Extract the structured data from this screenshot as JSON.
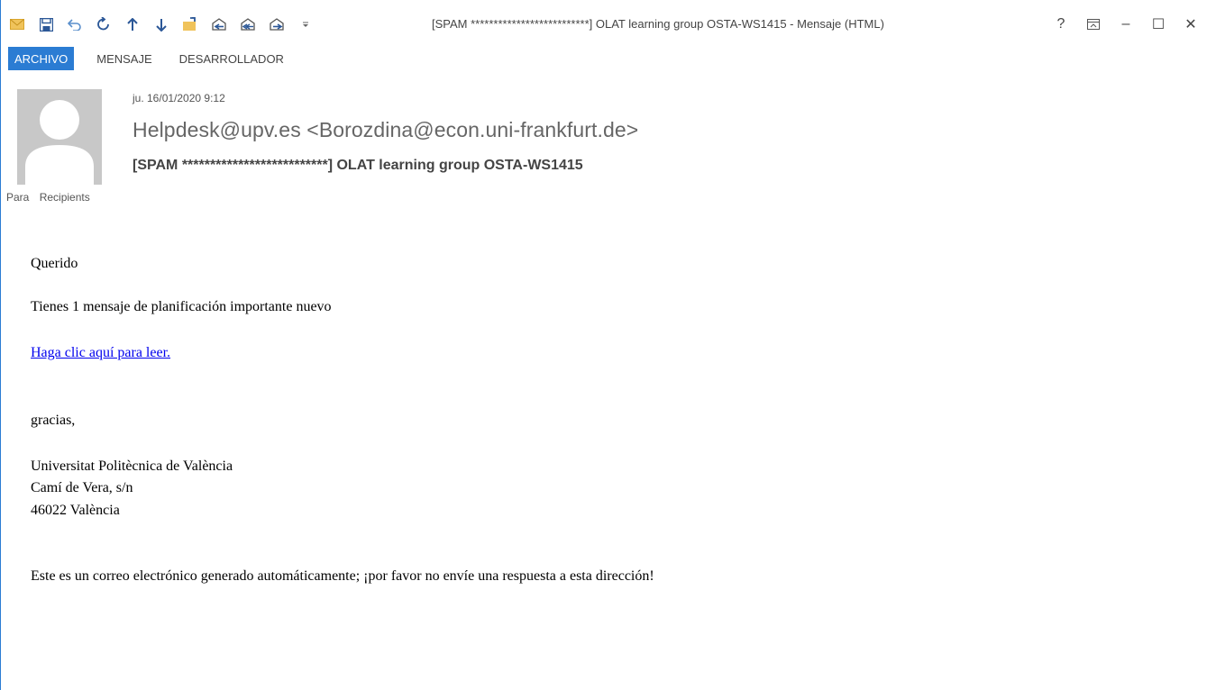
{
  "window": {
    "title": "[SPAM **************************] OLAT learning group OSTA-WS1415 - Mensaje (HTML)",
    "controls": {
      "help": "?",
      "restore_ribbon": "ribbon-display-icon",
      "minimize": "–",
      "maximize": "☐",
      "close": "✕"
    }
  },
  "quick_access": [
    "mail-icon",
    "save-icon",
    "undo-icon",
    "redo-icon",
    "up-arrow-icon",
    "down-arrow-icon",
    "move-folder-icon",
    "reply-icon",
    "reply-all-icon",
    "forward-icon",
    "customize-icon"
  ],
  "ribbon": {
    "tabs": [
      {
        "label": "ARCHIVO",
        "active": true
      },
      {
        "label": "MENSAJE",
        "active": false
      },
      {
        "label": "DESARROLLADOR",
        "active": false
      }
    ]
  },
  "header": {
    "date": "ju. 16/01/2020 9:12",
    "from": "Helpdesk@upv.es <Borozdina@econ.uni-frankfurt.de>",
    "subject": "[SPAM **************************] OLAT learning group OSTA-WS1415",
    "to_label": "Para",
    "to_value": "Recipients"
  },
  "body": {
    "greeting": "Querido",
    "line1": "Tienes 1 mensaje de planificación importante nuevo",
    "link": "Haga clic aquí para leer.",
    "thanks": "gracias,",
    "org1": "Universitat Politècnica de València",
    "org2": "Camí de Vera, s/n",
    "org3": "46022 València",
    "footer": "Este es un correo electrónico generado automáticamente; ¡por favor no envíe una respuesta a esta dirección!"
  },
  "colors": {
    "accent": "#2b7cd3",
    "link": "#0000ee",
    "avatar_bg": "#c8c8c8"
  }
}
